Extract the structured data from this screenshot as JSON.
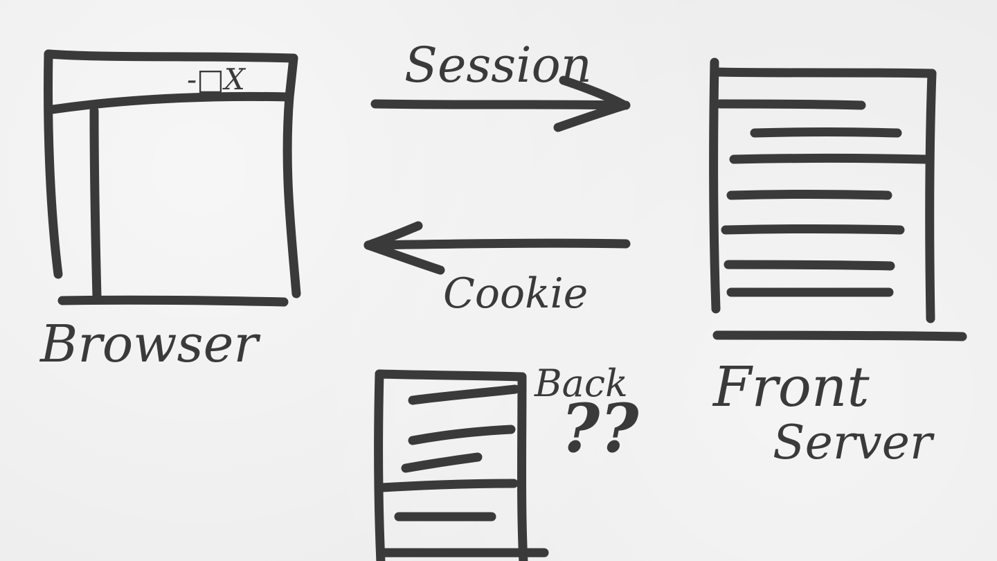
{
  "diagram": {
    "ink_color": "#3a3a3a",
    "background_color": "#ececec",
    "nodes": {
      "browser": {
        "label": "Browser",
        "window_controls": "-□X",
        "icon": "browser-window-icon"
      },
      "front_server": {
        "label_line1": "Front",
        "label_line2": "Server",
        "icon": "document-server-icon"
      },
      "back_server": {
        "label": "Back",
        "annotation": "??",
        "icon": "document-server-icon"
      }
    },
    "edges": [
      {
        "label": "Session",
        "from": "browser",
        "to": "front_server"
      },
      {
        "label": "Cookie",
        "from": "front_server",
        "to": "browser"
      }
    ]
  }
}
